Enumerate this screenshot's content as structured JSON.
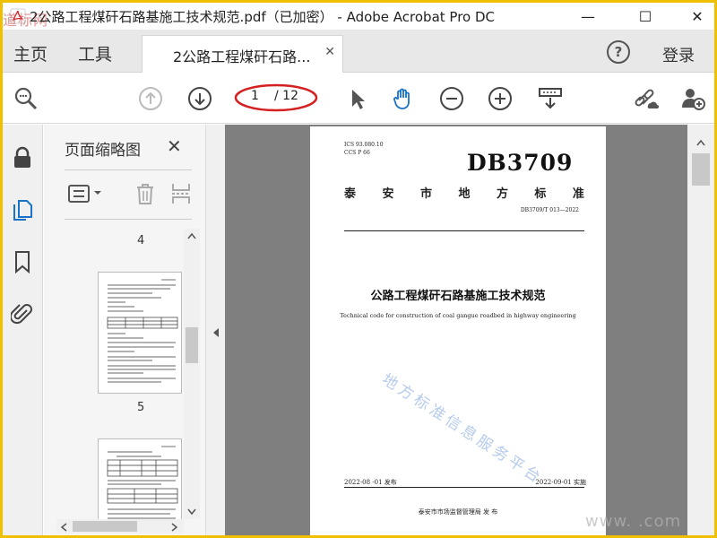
{
  "window": {
    "title": "2公路工程煤矸石路基施工技术规范.pdf（已加密） - Adobe Acrobat Pro DC",
    "overlay_logo": "道标网",
    "minimize": "—",
    "maximize": "☐",
    "close": "✕"
  },
  "tabs": {
    "home": "主页",
    "tools": "工具",
    "document": "2公路工程煤矸石路...",
    "document_close": "✕",
    "help": "?",
    "login": "登录"
  },
  "toolbar": {
    "page_current": "1",
    "page_total": "/ 12"
  },
  "thumbnails": {
    "title": "页面缩略图",
    "close": "✕",
    "page_labels": [
      "4",
      "5"
    ]
  },
  "document": {
    "ics": "ICS  93.080.10",
    "ccs": "CCS  P 66",
    "code": "DB3709",
    "type_chars": [
      "泰",
      "安",
      "市",
      "地",
      "方",
      "标",
      "准"
    ],
    "standard_no": "DB3709/T 013—2022",
    "title": "公路工程煤矸石路基施工技术规范",
    "subtitle": "Technical code for construction of coal gangue roadbed in highway engineering",
    "stamp": "地方标准信息服务平台",
    "publish_date": "2022-08 -01 发布",
    "implement_date": "2022-09-01 实施",
    "issuer": "泰安市市场监督管理局    发  布"
  },
  "corner_watermark": "www.          .com",
  "colors": {
    "frame": "#f0c000",
    "accent_blue": "#1a73c8",
    "highlight_red": "#d42020",
    "doc_bg": "#7f7f7f"
  }
}
